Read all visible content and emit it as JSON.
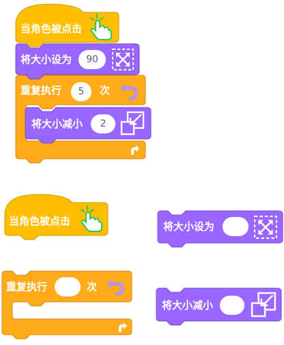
{
  "colors": {
    "event": "#FFBF00",
    "event_stroke": "#CC9900",
    "control": "#FFAB19",
    "control_stroke": "#CF8B17",
    "looks": "#9966FF",
    "looks_stroke": "#774DCB",
    "hand_green": "#2EC45B"
  },
  "script": {
    "hat_label": "当角色被点击",
    "set_size_label": "将大小设为",
    "set_size_value": "90",
    "repeat_label": "重复执行",
    "repeat_count": "5",
    "repeat_suffix": "次",
    "change_size_label": "将大小减小",
    "change_size_value": "2"
  },
  "palette": {
    "hat_label": "当角色被点击",
    "set_size_label": "将大小设为",
    "set_size_value": "",
    "repeat_label": "重复执行",
    "repeat_count": "",
    "repeat_suffix": "次",
    "change_size_label": "将大小减小",
    "change_size_value": ""
  },
  "icons": {
    "hat": "hand-pointer-icon",
    "set_size": "expand-arrows-icon",
    "change_size": "shrink-square-icon",
    "repeat_top": "loop-arrow-icon",
    "repeat_bottom": "repeat-end-arrow-icon"
  }
}
